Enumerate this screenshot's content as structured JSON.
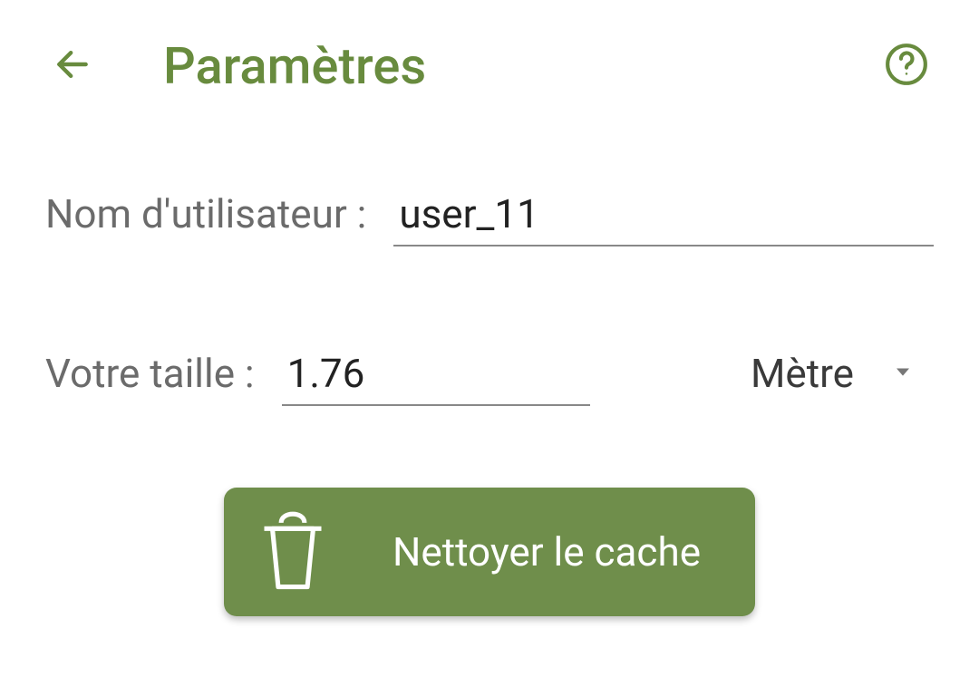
{
  "header": {
    "title": "Paramètres"
  },
  "form": {
    "username_label": "Nom d'utilisateur :",
    "username_value": "user_11",
    "height_label": "Votre taille :",
    "height_value": "1.76",
    "unit_selected": "Mètre"
  },
  "actions": {
    "clear_cache_label": "Nettoyer le cache"
  },
  "colors": {
    "accent": "#688b3e",
    "button_bg": "#6f8e4b"
  }
}
